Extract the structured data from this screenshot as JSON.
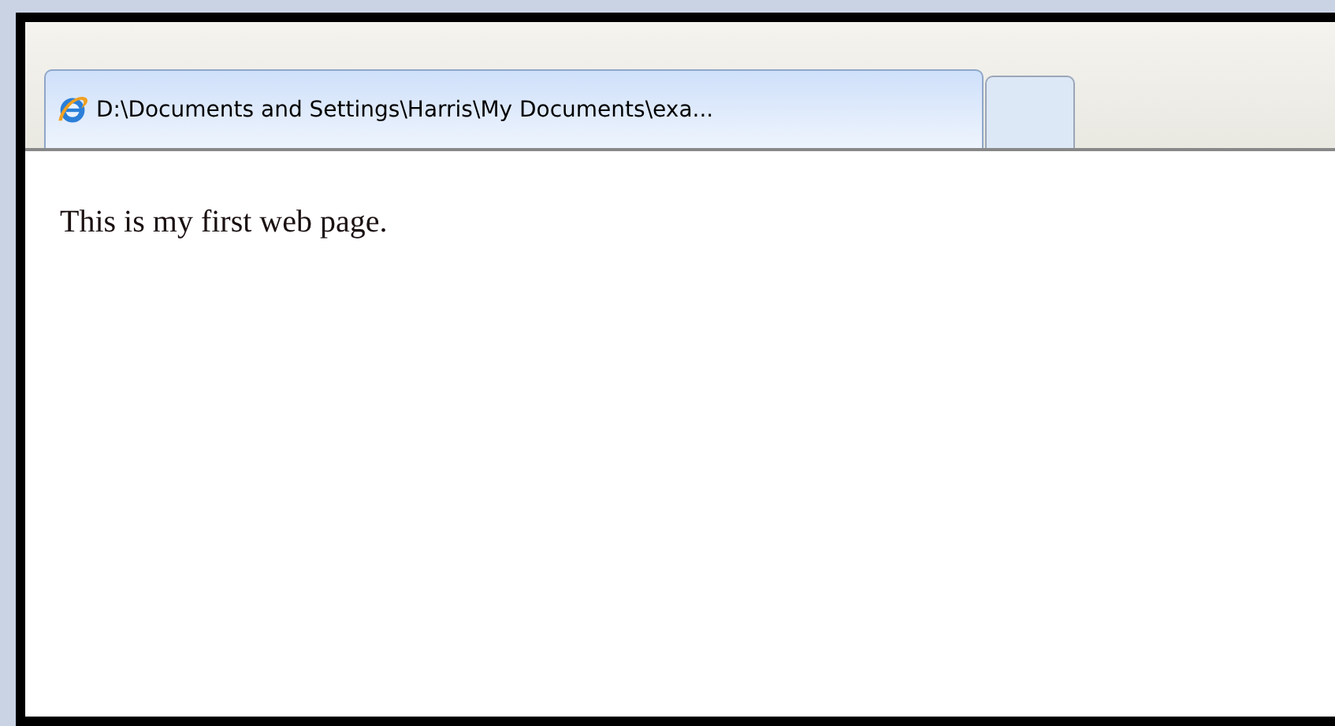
{
  "tabs": [
    {
      "label": "D:\\Documents and Settings\\Harris\\My Documents\\exa...",
      "selected": true
    }
  ],
  "page": {
    "text": "This is my first web page."
  }
}
